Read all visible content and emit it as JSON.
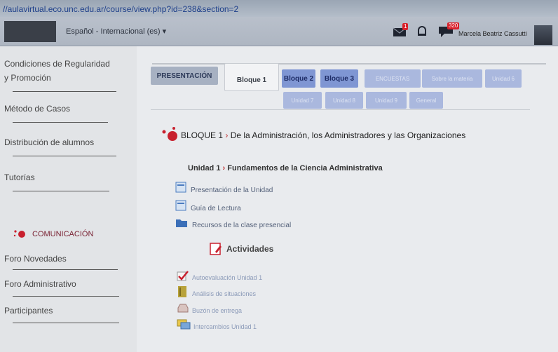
{
  "browser": {
    "url": "//aulavirtual.eco.unc.edu.ar/course/view.php?id=238&section=2"
  },
  "topbar": {
    "language": "Español - Internacional (es) ▾",
    "mail_badge": "1",
    "chat_badge": "320",
    "user_name": "Marcela Beatriz Cassutti"
  },
  "sidebar": {
    "condiciones_line1": "Condiciones de Regularidad",
    "condiciones_line2": "y Promoción",
    "metodo": "Método de Casos",
    "distribucion": "Distribución de alumnos",
    "tutorias": "Tutorías",
    "comunicacion": "COMUNICACIÓN",
    "foro_novedades": "Foro Novedades",
    "foro_administrativo": "Foro Administrativo",
    "participantes": "Participantes"
  },
  "tabs": {
    "presentacion": "PRESENTACIÓN",
    "bloque1": "Bloque 1",
    "bloque2": "Bloque 2",
    "bloque3": "Bloque 3",
    "encuestas": "ENCUESTAS",
    "sobre_materia": "Sobre la materia",
    "unidad6": "Unidad 6",
    "unidad7": "Unidad 7",
    "unidad8": "Unidad 8",
    "unidad9": "Unidad 9",
    "general": "General"
  },
  "content": {
    "bloque_label": "BLOQUE 1",
    "bloque_sep": "›",
    "bloque_title": "De la Administración, los Administradores y las Organizaciones",
    "unidad_label": "Unidad 1",
    "unidad_sep": "›",
    "unidad_title": "Fundamentos de la Ciencia Administrativa",
    "resources": [
      "Presentación de la Unidad",
      "Guía de Lectura",
      "Recursos de la clase presencial"
    ],
    "actividades": "Actividades",
    "activities": [
      "Autoevaluación Unidad 1",
      "Análisis de situaciones",
      "Buzón de entrega",
      "Intercambios Unidad 1"
    ]
  }
}
